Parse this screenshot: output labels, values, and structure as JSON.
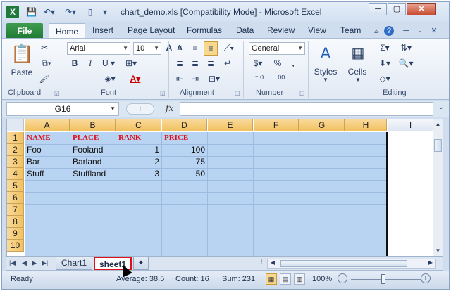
{
  "window": {
    "title": "chart_demo.xls  [Compatibility Mode]  -  Microsoft Excel",
    "minimize": "─",
    "maximize": "▢",
    "close": "✕",
    "app_letter": "X"
  },
  "ribbon_tabs": [
    "File",
    "Home",
    "Insert",
    "Page Layout",
    "Formulas",
    "Data",
    "Review",
    "View",
    "Team"
  ],
  "ribbon": {
    "clipboard": {
      "label": "Clipboard",
      "paste": "Paste"
    },
    "font": {
      "label": "Font",
      "name": "Arial",
      "size": "10"
    },
    "alignment": {
      "label": "Alignment"
    },
    "number": {
      "label": "Number",
      "format": "General"
    },
    "styles": {
      "label": "Styles"
    },
    "cells": {
      "label": "Cells"
    },
    "editing": {
      "label": "Editing"
    }
  },
  "formula_bar": {
    "name_box": "G16",
    "fx": "fx",
    "content": ""
  },
  "columns": [
    "A",
    "B",
    "C",
    "D",
    "E",
    "F",
    "G",
    "H",
    "I"
  ],
  "rows": [
    "1",
    "2",
    "3",
    "4",
    "5",
    "6",
    "7",
    "8",
    "9",
    "10"
  ],
  "table": {
    "headers": [
      "NAME",
      "PLACE",
      "RANK",
      "PRICE"
    ],
    "rows": [
      [
        "Foo",
        "Fooland",
        "1",
        "100"
      ],
      [
        "Bar",
        "Barland",
        "2",
        "75"
      ],
      [
        "Stuff",
        "Stuffland",
        "3",
        "50"
      ]
    ]
  },
  "sheets": [
    "Chart1",
    "sheet1"
  ],
  "status": {
    "ready": "Ready",
    "average": "Average: 38.5",
    "count": "Count: 16",
    "sum": "Sum: 231",
    "zoom": "100%"
  },
  "colors": {
    "selection": "#b8d4f2",
    "header_text": "#e0101a",
    "file_tab": "#1f7a34"
  }
}
